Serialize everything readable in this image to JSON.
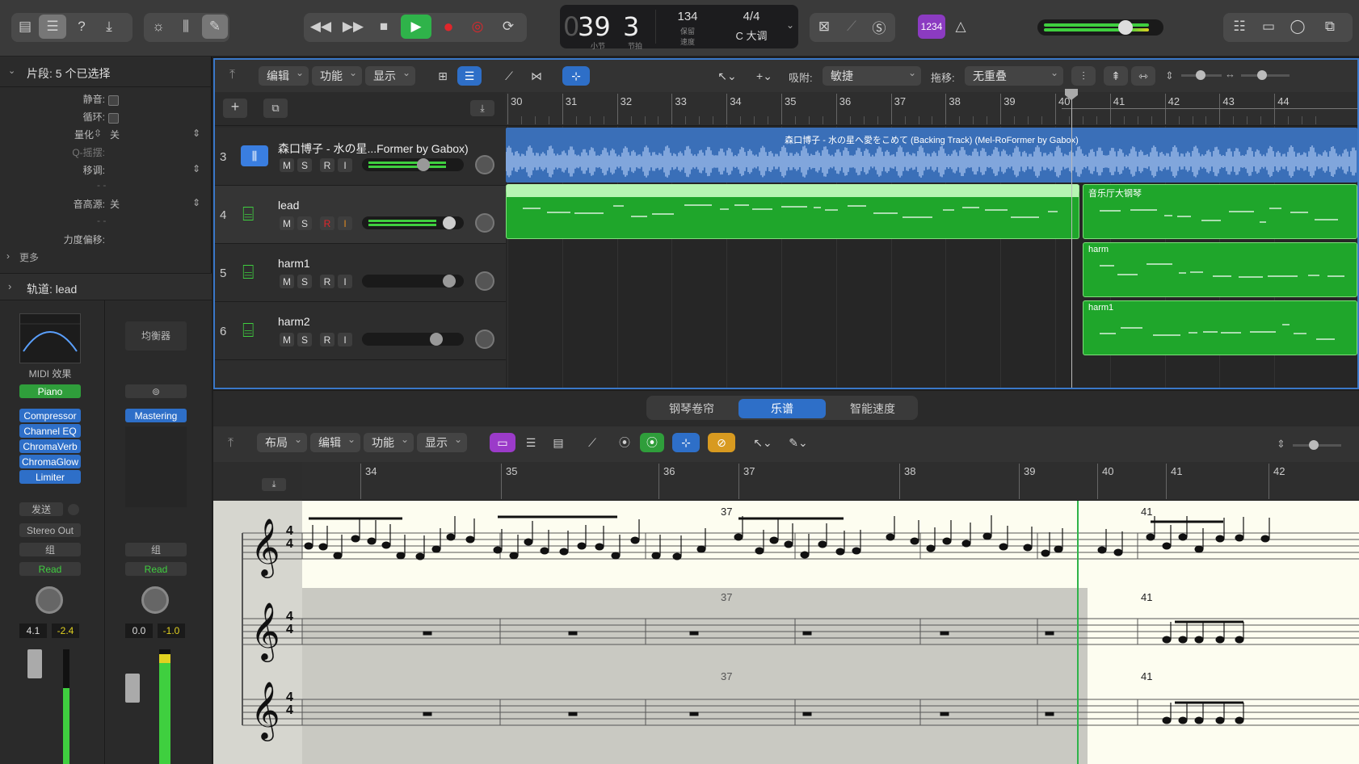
{
  "toolbar": {
    "lcd": {
      "bar": "39",
      "beat": "3",
      "bar_label": "小节",
      "beat_label": "节拍",
      "tempo": "134",
      "tempo_sub1": "保留",
      "tempo_sub2": "速度",
      "signature": "4/4",
      "key": "C 大调"
    },
    "count_in": "1234"
  },
  "inspector": {
    "region_header": "片段: 5 个已选择",
    "mute_label": "静音:",
    "loop_label": "循环:",
    "quantize_label": "量化",
    "quantize_value": "关",
    "q_swing_label": "Q-摇摆:",
    "transpose_label": "移调:",
    "transpose_value": "- -",
    "velocity_label": "音高源:",
    "velocity_value": "关",
    "velocity_dash": "- -",
    "dynamics_label": "力度偏移:",
    "more_label": "更多",
    "track_header": "轨道: lead",
    "strip1": {
      "midi_fx": "MIDI 效果",
      "instrument": "Piano",
      "plugins": [
        "Compressor",
        "Channel EQ",
        "ChromaVerb",
        "ChromaGlow",
        "Limiter"
      ],
      "sends": "发送",
      "output": "Stereo Out",
      "group": "组",
      "automation": "Read",
      "vol": "4.1",
      "peak": "-2.4"
    },
    "strip2": {
      "eq": "均衡器",
      "plugins": [
        "Mastering"
      ],
      "group": "组",
      "automation": "Read",
      "vol": "0.0",
      "peak": "-1.0"
    }
  },
  "tracks_toolbar": {
    "edit": "编辑",
    "functions": "功能",
    "view": "显示",
    "snap_label": "吸附:",
    "snap_value": "敏捷",
    "drag_label": "拖移:",
    "drag_value": "无重叠"
  },
  "ruler": [
    "30",
    "31",
    "32",
    "33",
    "34",
    "35",
    "36",
    "37",
    "38",
    "39",
    "40",
    "41",
    "42",
    "43",
    "44"
  ],
  "tracks": [
    {
      "num": "3",
      "name": "森口博子 - 水の星...Former by Gabox)",
      "region": "森口博子 - 水の星へ愛をこめて (Backing Track) (Mel-RoFormer by Gabox)"
    },
    {
      "num": "4",
      "name": "lead",
      "region": "音乐厅大钢琴"
    },
    {
      "num": "5",
      "name": "harm1",
      "region": "harm"
    },
    {
      "num": "6",
      "name": "harm2",
      "region": "harm1"
    }
  ],
  "editor": {
    "tabs": [
      "钢琴卷帘",
      "乐谱",
      "智能速度"
    ],
    "layout": "布局",
    "edit": "编辑",
    "functions": "功能",
    "view": "显示",
    "ruler": [
      "34",
      "35",
      "36",
      "37",
      "38",
      "39",
      "40",
      "41",
      "42"
    ],
    "measure_37": "37",
    "measure_41": "41"
  },
  "colors": {
    "accent": "#2e6fc8",
    "midi_green": "#1fa62b",
    "audio_blue": "#3a6fb8",
    "play": "#2fb34a",
    "record": "#e0262b"
  }
}
